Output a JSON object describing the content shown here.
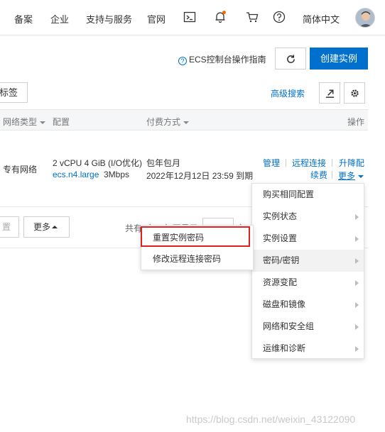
{
  "topnav": {
    "items": [
      "备案",
      "企业",
      "支持与服务",
      "官网"
    ],
    "language": "简体中文",
    "icons": [
      "terminal-icon",
      "bell-icon",
      "cart-icon",
      "help-icon"
    ],
    "notification_dot_color": "#ff6a00"
  },
  "actions": {
    "guide_label": "ECS控制台操作指南",
    "create_label": "创建实例",
    "tag_label": "标签",
    "advanced_search": "高级搜索"
  },
  "table": {
    "headers": {
      "network_type": "网络类型",
      "config": "配置",
      "billing": "付费方式",
      "actions": "操作"
    },
    "row": {
      "network": "专有网络",
      "config_line1": "2 vCPU 4 GiB (I/O优化)",
      "instance_type": "ecs.n4.large",
      "bandwidth": "3Mbps",
      "billing_type": "包年包月",
      "expire": "2022年12月12日 23:59 到期",
      "action_manage": "管理",
      "action_remote": "远程连接",
      "action_upgrade": "升降配",
      "action_renew": "续费",
      "action_more": "更多"
    }
  },
  "footer": {
    "btn_reset": "置",
    "btn_more": "更多",
    "pagination_text": "共有1条，每页显示",
    "per_page_suffix": "条"
  },
  "menu": {
    "items": [
      "购买相同配置",
      "实例状态",
      "实例设置",
      "密码/密钥",
      "资源变配",
      "磁盘和镜像",
      "网络和安全组",
      "运维和诊断"
    ]
  },
  "submenu": {
    "items": [
      "重置实例密码",
      "修改远程连接密码"
    ]
  },
  "colors": {
    "primary": "#0070cc",
    "highlight": "#e02020"
  },
  "watermark": "https://blog.csdn.net/weixin_43122090"
}
